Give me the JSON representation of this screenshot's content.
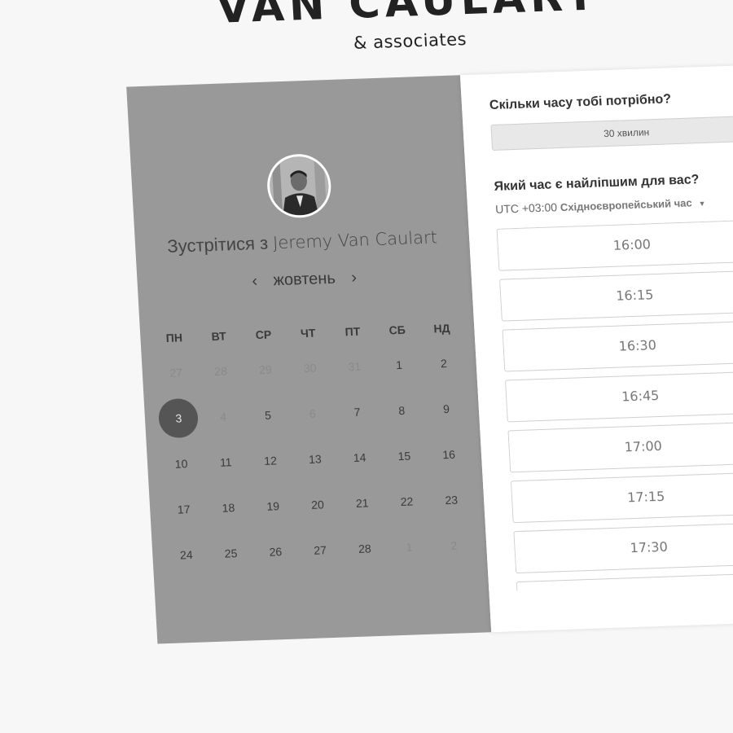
{
  "brand": {
    "title": "VAN CAULART",
    "subtitle": "& associates"
  },
  "host": {
    "prefix": "Зустрітися з",
    "name": "Jeremy Van Caulart"
  },
  "calendar": {
    "month": "жовтень",
    "prev": "‹",
    "next": "›",
    "weekdays": [
      "ПН",
      "ВТ",
      "СР",
      "ЧТ",
      "ПТ",
      "СБ",
      "НД"
    ],
    "weeks": [
      [
        {
          "d": "27",
          "dim": true
        },
        {
          "d": "28",
          "dim": true
        },
        {
          "d": "29",
          "dim": true
        },
        {
          "d": "30",
          "dim": true
        },
        {
          "d": "31",
          "dim": true
        },
        {
          "d": "1"
        },
        {
          "d": "2"
        }
      ],
      [
        {
          "d": "3",
          "selected": true
        },
        {
          "d": "4",
          "dim": true
        },
        {
          "d": "5"
        },
        {
          "d": "6",
          "dim": true
        },
        {
          "d": "7"
        },
        {
          "d": "8"
        },
        {
          "d": "9"
        }
      ],
      [
        {
          "d": "10"
        },
        {
          "d": "11"
        },
        {
          "d": "12"
        },
        {
          "d": "13"
        },
        {
          "d": "14"
        },
        {
          "d": "15"
        },
        {
          "d": "16"
        }
      ],
      [
        {
          "d": "17"
        },
        {
          "d": "18"
        },
        {
          "d": "19"
        },
        {
          "d": "20"
        },
        {
          "d": "21"
        },
        {
          "d": "22"
        },
        {
          "d": "23"
        }
      ],
      [
        {
          "d": "24"
        },
        {
          "d": "25"
        },
        {
          "d": "26"
        },
        {
          "d": "27"
        },
        {
          "d": "28"
        },
        {
          "d": "1",
          "dim": true
        },
        {
          "d": "2",
          "dim": true
        }
      ]
    ]
  },
  "duration": {
    "label": "Скільки часу тобі потрібно?",
    "value": "30 хвилин"
  },
  "time": {
    "label": "Який час є найліпшим для вас?",
    "tz_offset": "UTC +03:00",
    "tz_name": "Східноєвропейський час",
    "caret": "▼",
    "slots": [
      "16:00",
      "16:15",
      "16:30",
      "16:45",
      "17:00",
      "17:15",
      "17:30",
      ""
    ]
  },
  "colors": {
    "left_panel": "#999999",
    "selected_day": "#555555",
    "page_bg": "#f7f7f7"
  }
}
